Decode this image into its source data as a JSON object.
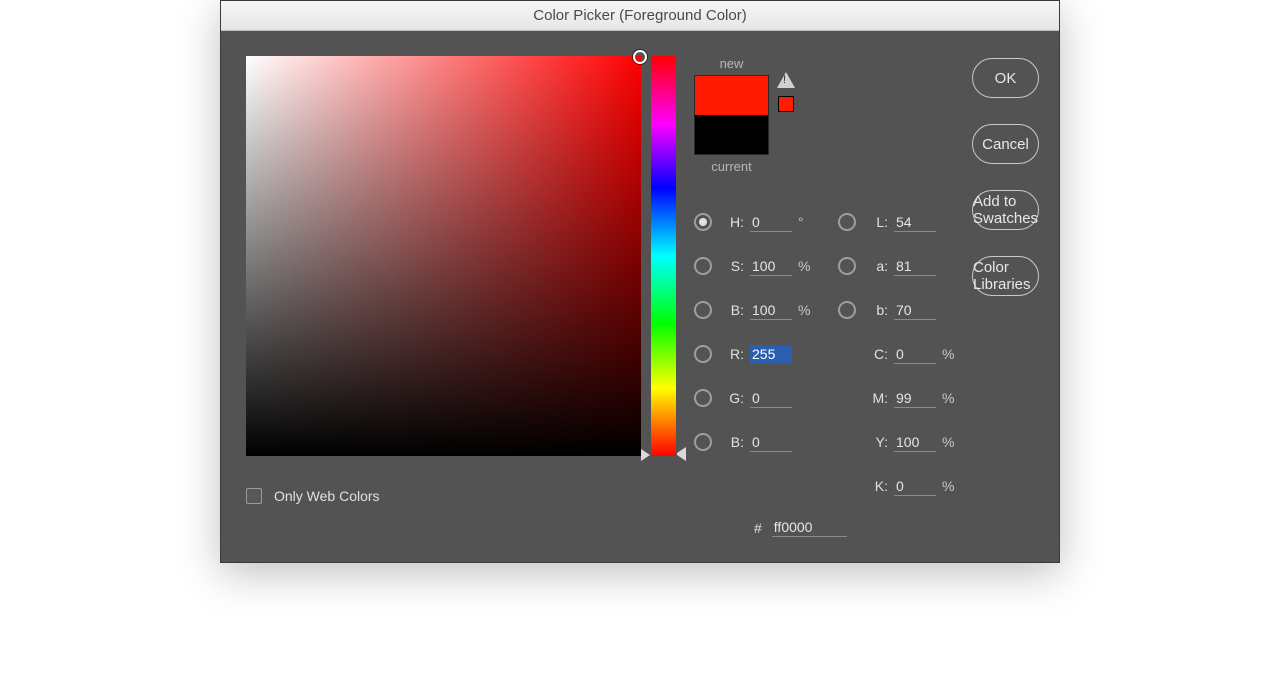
{
  "dialog": {
    "title": "Color Picker (Foreground Color)",
    "only_web_colors": "Only Web Colors"
  },
  "swatch": {
    "new_label": "new",
    "current_label": "current",
    "new_color": "#ff1a00",
    "current_color": "#000000"
  },
  "buttons": {
    "ok": "OK",
    "cancel": "Cancel",
    "add_swatches": "Add to Swatches",
    "color_libraries": "Color Libraries"
  },
  "hsb": {
    "h_label": "H:",
    "h_value": "0",
    "h_unit": "°",
    "s_label": "S:",
    "s_value": "100",
    "s_unit": "%",
    "b_label": "B:",
    "b_value": "100",
    "b_unit": "%"
  },
  "rgb": {
    "r_label": "R:",
    "r_value": "255",
    "g_label": "G:",
    "g_value": "0",
    "b_label": "B:",
    "b_value": "0"
  },
  "lab": {
    "l_label": "L:",
    "l_value": "54",
    "a_label": "a:",
    "a_value": "81",
    "b_label": "b:",
    "b_value": "70"
  },
  "cmyk": {
    "c_label": "C:",
    "c_value": "0",
    "unit": "%",
    "m_label": "M:",
    "m_value": "99",
    "y_label": "Y:",
    "y_value": "100",
    "k_label": "K:",
    "k_value": "0"
  },
  "hex": {
    "label": "#",
    "value": "ff0000"
  }
}
